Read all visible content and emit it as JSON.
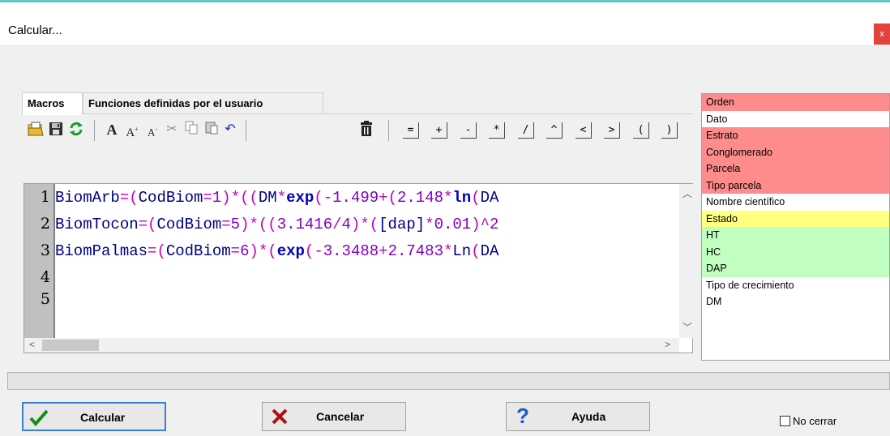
{
  "window": {
    "title": "Calcular...",
    "close_label": "x"
  },
  "tabs": [
    {
      "label": "Macros",
      "active": true
    },
    {
      "label": "Funciones definidas por el usuario",
      "active": false
    }
  ],
  "toolbar": {
    "icons": [
      "open-icon",
      "save-icon",
      "refresh-icon",
      "bold-font-icon",
      "font-grow-icon",
      "font-shrink-icon",
      "cut-icon",
      "copy-icon",
      "paste-icon",
      "undo-icon",
      "delete-icon"
    ],
    "operators": [
      "=",
      "+",
      "-",
      "*",
      "/",
      "^",
      "<",
      ">",
      "(",
      ")"
    ]
  },
  "editor": {
    "line_numbers": [
      "1",
      "2",
      "3",
      "4",
      "5"
    ],
    "lines": [
      "BiomArb=(CodBiom=1)*((DM*exp(-1.499+(2.148*ln(DA",
      "BiomTocon=(CodBiom=5)*((3.1416/4)*([dap]*0.01)^2",
      "BiomPalmas=(CodBiom=6)*(exp(-3.3488+2.7483*Ln(DA",
      "",
      ""
    ]
  },
  "fields": [
    {
      "name": "Orden",
      "color": "#ff8c8c"
    },
    {
      "name": "Dato",
      "color": "#ffffff"
    },
    {
      "name": "Estrato",
      "color": "#ff8c8c"
    },
    {
      "name": "Conglomerado",
      "color": "#ff8c8c"
    },
    {
      "name": "Parcela",
      "color": "#ff8c8c"
    },
    {
      "name": "Tipo parcela",
      "color": "#ff8c8c"
    },
    {
      "name": "Nombre científico",
      "color": "#ffffff"
    },
    {
      "name": "Estado",
      "color": "#ffff80"
    },
    {
      "name": "HT",
      "color": "#c0ffc0"
    },
    {
      "name": "HC",
      "color": "#c0ffc0"
    },
    {
      "name": "DAP",
      "color": "#c0ffc0"
    },
    {
      "name": "Tipo de crecimiento",
      "color": "#ffffff"
    },
    {
      "name": "DM",
      "color": "#ffffff"
    }
  ],
  "buttons": {
    "calcular": "Calcular",
    "cancelar": "Cancelar",
    "ayuda": "Ayuda"
  },
  "no_cerrar": {
    "label": "No cerrar",
    "checked": false
  }
}
